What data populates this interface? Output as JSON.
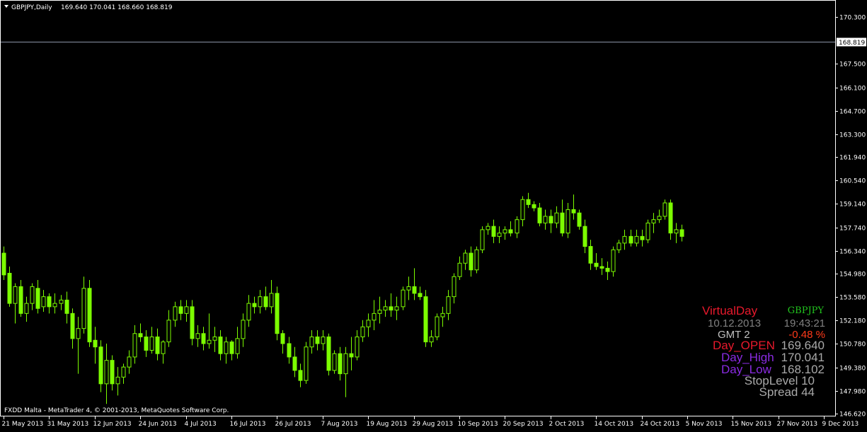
{
  "header": {
    "symbol_timeframe": "GBPJPY,Daily",
    "ohlc": "169.640 170.041 168.660 168.819"
  },
  "footer": {
    "copyright": "FXDD Malta - MetaTrader 4, © 2001-2013, MetaQuotes Software Corp."
  },
  "colors": {
    "background": "#000000",
    "candle": "#7CFC00",
    "axis": "#ffffff",
    "bid_line": "#8c95a8",
    "price_badge_bg": "#ffffff",
    "price_badge_text": "#000000"
  },
  "overlay": {
    "title": "VirtualDay",
    "symbol": "GBPJPY",
    "date": "10.12.2013",
    "time": "19:43:21",
    "gmt": "GMT 2",
    "change": "-0.48 %",
    "day_open_label": "Day_OPEN",
    "day_open_value": "169.640",
    "day_high_label": "Day_High",
    "day_high_value": "170.041",
    "day_low_label": "Day_Low",
    "day_low_value": "168.102",
    "stoplevel": "StopLevel 10",
    "spread": "Spread  44",
    "colors": {
      "title": "#e8192c",
      "symbol": "#22c51e",
      "date": "#808080",
      "time": "#808080",
      "gmt": "#c0c0c0",
      "change": "#ff3a1a",
      "day_open_label": "#e8192c",
      "day_high_label": "#8a2be2",
      "day_low_label": "#8a2be2",
      "value": "#a9a9a9",
      "stoplevel": "#a9a9a9",
      "spread": "#a9a9a9"
    }
  },
  "chart_data": {
    "type": "candlestick",
    "ylim": [
      146.62,
      170.3
    ],
    "y_ticks": [
      "170.300",
      "167.500",
      "166.100",
      "164.700",
      "163.300",
      "161.940",
      "160.540",
      "159.140",
      "157.740",
      "156.340",
      "154.980",
      "153.580",
      "152.180",
      "150.780",
      "149.380",
      "147.980",
      "146.620"
    ],
    "y_tick_values": [
      170.3,
      167.5,
      166.1,
      164.7,
      163.3,
      161.94,
      160.54,
      159.14,
      157.74,
      156.34,
      154.98,
      153.58,
      152.18,
      150.78,
      149.38,
      147.98,
      146.62
    ],
    "x_labels": [
      "21 May 2013",
      "31 May 2013",
      "12 Jun 2013",
      "24 Jun 2013",
      "4 Jul 2013",
      "16 Jul 2013",
      "26 Jul 2013",
      "7 Aug 2013",
      "19 Aug 2013",
      "29 Aug 2013",
      "10 Sep 2013",
      "20 Sep 2013",
      "2 Oct 2013",
      "14 Oct 2013",
      "24 Oct 2013",
      "5 Nov 2013",
      "15 Nov 2013",
      "27 Nov 2013",
      "9 Dec 2013"
    ],
    "x_label_bar_index": [
      0,
      8,
      16,
      24,
      32,
      40,
      48,
      56,
      64,
      72,
      80,
      88,
      96,
      104,
      112,
      120,
      128,
      136,
      144
    ],
    "bid_price": 168.819,
    "bid_label": "168.819",
    "ohlc": [
      [
        156.2,
        156.6,
        154.6,
        154.9
      ],
      [
        155.0,
        155.4,
        153.0,
        153.2
      ],
      [
        153.2,
        154.4,
        152.0,
        154.2
      ],
      [
        154.2,
        154.6,
        152.4,
        152.6
      ],
      [
        152.6,
        153.6,
        152.1,
        153.2
      ],
      [
        153.2,
        154.4,
        152.8,
        154.2
      ],
      [
        154.1,
        154.6,
        152.6,
        152.9
      ],
      [
        153.0,
        154.0,
        152.7,
        153.6
      ],
      [
        153.6,
        153.8,
        152.6,
        153.0
      ],
      [
        153.0,
        153.8,
        152.6,
        153.2
      ],
      [
        153.2,
        153.7,
        152.8,
        153.4
      ],
      [
        153.4,
        153.9,
        152.0,
        152.6
      ],
      [
        152.6,
        152.9,
        150.5,
        151.1
      ],
      [
        151.1,
        152.4,
        149.0,
        151.7
      ],
      [
        151.7,
        154.8,
        151.4,
        154.1
      ],
      [
        154.1,
        154.6,
        150.6,
        150.9
      ],
      [
        151.0,
        151.8,
        149.6,
        150.6
      ],
      [
        150.6,
        151.0,
        147.9,
        148.4
      ],
      [
        148.4,
        150.8,
        147.2,
        149.8
      ],
      [
        149.8,
        150.1,
        148.0,
        148.4
      ],
      [
        148.4,
        149.4,
        147.7,
        148.8
      ],
      [
        148.8,
        149.6,
        148.4,
        149.4
      ],
      [
        149.4,
        150.4,
        149.0,
        150.0
      ],
      [
        150.0,
        151.9,
        149.6,
        151.4
      ],
      [
        151.4,
        152.0,
        150.9,
        151.2
      ],
      [
        151.2,
        151.6,
        150.0,
        150.4
      ],
      [
        150.4,
        151.8,
        150.2,
        151.2
      ],
      [
        151.2,
        151.7,
        149.8,
        150.2
      ],
      [
        150.2,
        151.0,
        149.6,
        150.9
      ],
      [
        150.9,
        152.8,
        150.6,
        152.2
      ],
      [
        152.2,
        153.3,
        151.8,
        153.0
      ],
      [
        153.0,
        153.4,
        152.2,
        152.6
      ],
      [
        152.6,
        153.4,
        152.1,
        153.0
      ],
      [
        153.0,
        153.4,
        150.7,
        151.1
      ],
      [
        151.1,
        151.9,
        150.6,
        151.4
      ],
      [
        151.4,
        151.8,
        150.4,
        150.8
      ],
      [
        150.8,
        152.6,
        150.5,
        151.0
      ],
      [
        151.0,
        151.8,
        150.3,
        151.2
      ],
      [
        151.2,
        151.6,
        149.8,
        150.2
      ],
      [
        150.2,
        151.2,
        149.6,
        150.9
      ],
      [
        150.9,
        151.0,
        149.8,
        150.2
      ],
      [
        150.2,
        151.8,
        149.9,
        151.1
      ],
      [
        151.1,
        152.6,
        150.6,
        152.2
      ],
      [
        152.2,
        153.7,
        151.8,
        153.2
      ],
      [
        153.2,
        153.6,
        152.6,
        153.0
      ],
      [
        153.0,
        154.0,
        152.6,
        153.6
      ],
      [
        153.6,
        154.2,
        152.8,
        153.0
      ],
      [
        153.0,
        154.6,
        152.6,
        153.8
      ],
      [
        153.8,
        154.2,
        151.0,
        151.4
      ],
      [
        151.4,
        151.6,
        150.2,
        150.8
      ],
      [
        150.8,
        151.2,
        149.6,
        150.0
      ],
      [
        150.0,
        150.6,
        148.8,
        149.2
      ],
      [
        149.2,
        149.6,
        148.2,
        148.6
      ],
      [
        148.6,
        150.9,
        148.4,
        150.6
      ],
      [
        150.6,
        151.6,
        150.2,
        151.2
      ],
      [
        151.2,
        151.6,
        150.4,
        150.8
      ],
      [
        150.8,
        151.6,
        150.4,
        151.2
      ],
      [
        151.2,
        151.4,
        148.9,
        149.2
      ],
      [
        149.2,
        150.4,
        149.0,
        150.2
      ],
      [
        150.2,
        150.6,
        148.6,
        149.0
      ],
      [
        149.0,
        150.6,
        147.6,
        150.2
      ],
      [
        150.2,
        151.2,
        149.2,
        150.0
      ],
      [
        150.0,
        151.6,
        149.8,
        151.2
      ],
      [
        151.2,
        152.2,
        150.9,
        151.8
      ],
      [
        151.8,
        152.6,
        151.2,
        152.2
      ],
      [
        152.2,
        153.4,
        151.6,
        152.6
      ],
      [
        152.6,
        153.6,
        152.0,
        152.8
      ],
      [
        152.8,
        153.4,
        152.4,
        153.0
      ],
      [
        153.0,
        153.8,
        152.4,
        152.8
      ],
      [
        152.8,
        153.6,
        152.2,
        153.0
      ],
      [
        153.0,
        154.2,
        152.8,
        154.0
      ],
      [
        154.0,
        154.8,
        153.4,
        154.2
      ],
      [
        154.2,
        155.3,
        153.4,
        153.8
      ],
      [
        153.8,
        154.2,
        153.4,
        153.6
      ],
      [
        153.6,
        154.0,
        150.6,
        150.9
      ],
      [
        150.9,
        151.6,
        150.6,
        151.2
      ],
      [
        151.2,
        152.6,
        151.0,
        152.4
      ],
      [
        152.4,
        153.0,
        151.8,
        152.6
      ],
      [
        152.6,
        154.0,
        152.2,
        153.6
      ],
      [
        153.6,
        155.0,
        153.2,
        154.8
      ],
      [
        154.8,
        156.0,
        154.6,
        155.6
      ],
      [
        155.6,
        156.4,
        155.2,
        156.2
      ],
      [
        156.2,
        156.6,
        154.8,
        155.2
      ],
      [
        155.2,
        156.6,
        155.0,
        156.4
      ],
      [
        156.4,
        157.8,
        156.2,
        157.6
      ],
      [
        157.6,
        158.0,
        157.3,
        157.8
      ],
      [
        157.8,
        158.2,
        156.8,
        157.2
      ],
      [
        157.2,
        157.8,
        156.8,
        157.4
      ],
      [
        157.4,
        157.8,
        157.0,
        157.6
      ],
      [
        157.6,
        158.1,
        157.2,
        157.4
      ],
      [
        157.4,
        158.4,
        157.1,
        158.2
      ],
      [
        158.2,
        159.6,
        157.8,
        159.4
      ],
      [
        159.4,
        159.8,
        158.9,
        159.1
      ],
      [
        159.1,
        159.3,
        158.7,
        158.9
      ],
      [
        158.9,
        159.2,
        157.8,
        158.0
      ],
      [
        158.0,
        158.8,
        157.6,
        158.4
      ],
      [
        158.4,
        158.8,
        157.4,
        158.0
      ],
      [
        158.0,
        159.0,
        157.7,
        158.6
      ],
      [
        158.6,
        159.4,
        157.2,
        157.4
      ],
      [
        157.4,
        159.2,
        157.1,
        158.8
      ],
      [
        158.8,
        159.7,
        158.2,
        158.6
      ],
      [
        158.6,
        158.8,
        157.6,
        157.8
      ],
      [
        157.8,
        158.2,
        156.2,
        156.6
      ],
      [
        156.6,
        157.0,
        155.2,
        155.6
      ],
      [
        155.6,
        156.2,
        155.2,
        155.4
      ],
      [
        155.4,
        155.9,
        154.9,
        155.3
      ],
      [
        155.3,
        155.7,
        154.6,
        155.1
      ],
      [
        155.1,
        156.6,
        154.8,
        156.4
      ],
      [
        156.4,
        157.0,
        156.2,
        156.8
      ],
      [
        156.8,
        157.6,
        156.4,
        157.2
      ],
      [
        157.2,
        157.6,
        156.6,
        156.8
      ],
      [
        156.8,
        157.6,
        156.6,
        157.2
      ],
      [
        157.2,
        157.6,
        156.6,
        157.0
      ],
      [
        157.0,
        158.2,
        156.8,
        158.0
      ],
      [
        158.0,
        158.6,
        157.4,
        158.2
      ],
      [
        158.2,
        158.8,
        158.0,
        158.4
      ],
      [
        158.4,
        159.4,
        158.2,
        159.2
      ],
      [
        159.2,
        159.4,
        157.0,
        157.4
      ],
      [
        157.4,
        158.0,
        156.8,
        157.6
      ],
      [
        157.6,
        157.9,
        156.9,
        157.2
      ]
    ]
  }
}
